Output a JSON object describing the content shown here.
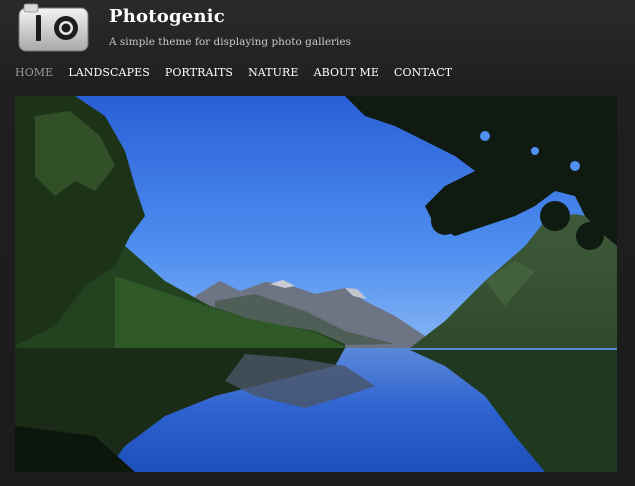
{
  "site": {
    "title": "Photogenic",
    "tagline": "A simple theme for displaying photo galleries",
    "logo_icon": "camera-icon"
  },
  "nav": {
    "items": [
      {
        "label": "Home",
        "active": true
      },
      {
        "label": "Landscapes",
        "active": false
      },
      {
        "label": "Portraits",
        "active": false
      },
      {
        "label": "Nature",
        "active": false
      },
      {
        "label": "About Me",
        "active": false
      },
      {
        "label": "Contact",
        "active": false
      }
    ]
  },
  "colors": {
    "background": "#1c1c1c",
    "nav_active": "#9a9a9a",
    "text": "#ffffff",
    "sky_top": "#2f66d8",
    "water": "#2b5fcf"
  }
}
